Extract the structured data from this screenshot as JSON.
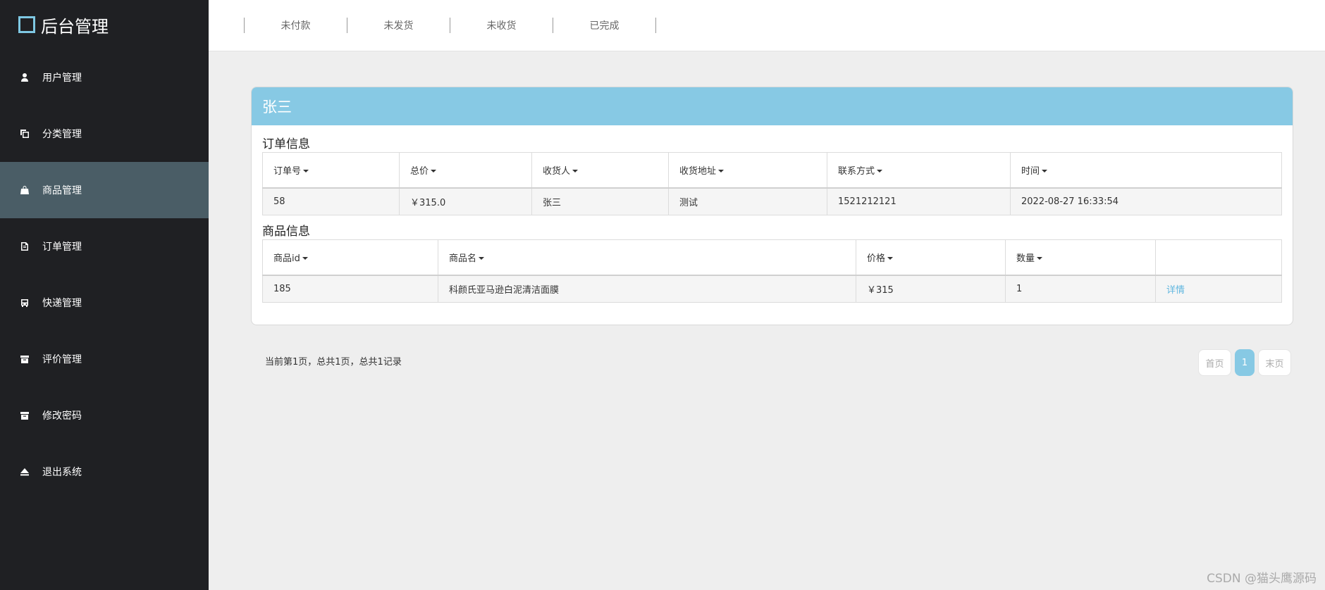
{
  "app": {
    "title": "后台管理"
  },
  "sidebar": {
    "items": [
      {
        "label": "用户管理",
        "icon": "user-icon"
      },
      {
        "label": "分类管理",
        "icon": "copy-icon"
      },
      {
        "label": "商品管理",
        "icon": "shopping-bag-icon",
        "active": true
      },
      {
        "label": "订单管理",
        "icon": "document-icon"
      },
      {
        "label": "快递管理",
        "icon": "bus-icon"
      },
      {
        "label": "评价管理",
        "icon": "archive-icon"
      },
      {
        "label": "修改密码",
        "icon": "archive-icon"
      },
      {
        "label": "退出系统",
        "icon": "eject-icon"
      }
    ]
  },
  "topbar": {
    "tabs": [
      "未付款",
      "未发货",
      "未收货",
      "已完成"
    ]
  },
  "card": {
    "header": "张三",
    "order_section": {
      "title": "订单信息",
      "columns": [
        "订单号",
        "总价",
        "收货人",
        "收货地址",
        "联系方式",
        "时间"
      ],
      "rows": [
        [
          "58",
          "￥315.0",
          "张三",
          "测试",
          "1521212121",
          "2022-08-27 16:33:54"
        ]
      ]
    },
    "goods_section": {
      "title": "商品信息",
      "columns": [
        "商品id",
        "商品名",
        "价格",
        "数量",
        ""
      ],
      "rows": [
        [
          "185",
          "科颜氏亚马逊白泥清洁面膜",
          "￥315",
          "1",
          "详情"
        ]
      ]
    }
  },
  "pagination": {
    "info": "当前第1页，总共1页，总共1记录",
    "first": "首页",
    "current": "1",
    "last": "末页"
  },
  "watermark": "CSDN @猫头鹰源码"
}
